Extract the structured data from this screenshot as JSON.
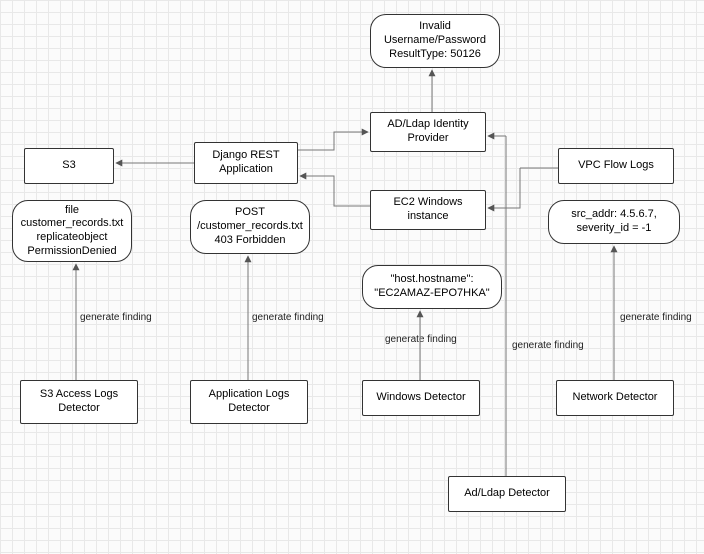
{
  "nodes": {
    "s3": "S3",
    "django": "Django REST\nApplication",
    "adldap_provider": "AD/Ldap Identity\nProvider",
    "vpc": "VPC Flow Logs",
    "ec2": "EC2 Windows\ninstance",
    "invalid_creds": "Invalid\nUsername/Password\nResultType: 50126",
    "file_note": "file\ncustomer_records.txt\nreplicateobject\nPermissionDenied",
    "post_note": "POST\n/customer_records.txt\n403 Forbidden",
    "host_note": "\"host.hostname\":\n\"EC2AMAZ-EPO7HKA\"",
    "src_note": "src_addr: 4.5.6.7,\nseverity_id = -1",
    "s3_detector": "S3 Access Logs\nDetector",
    "app_detector": "Application Logs\nDetector",
    "win_detector": "Windows Detector",
    "net_detector": "Network Detector",
    "adldap_detector": "Ad/Ldap Detector"
  },
  "labels": {
    "gen1": "generate finding",
    "gen2": "generate finding",
    "gen3": "generate finding",
    "gen4": "generate finding",
    "gen5": "generate finding"
  }
}
